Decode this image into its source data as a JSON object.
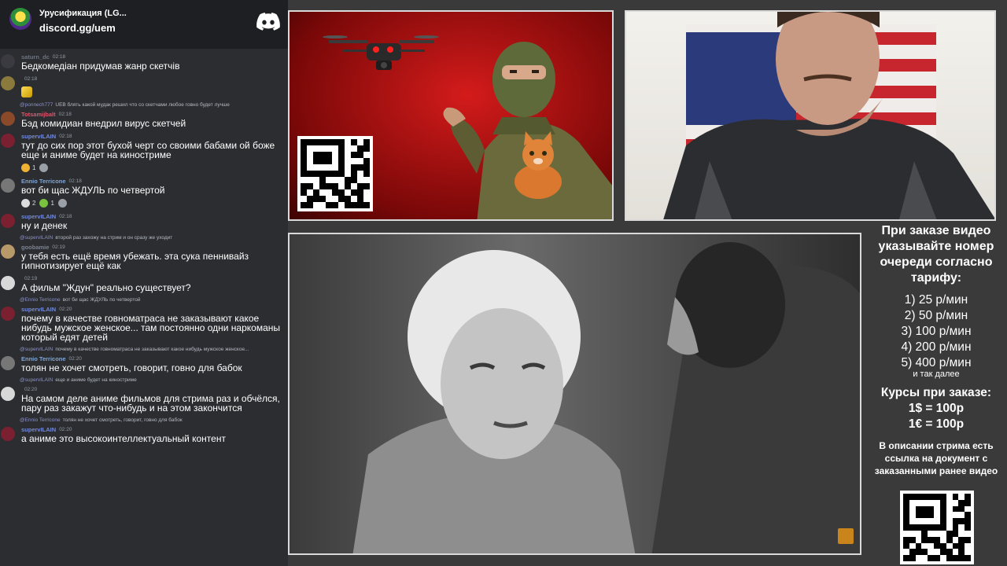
{
  "header": {
    "server_name": "Урусификация (LG...",
    "invite": "discord.gg/uem"
  },
  "messages": [
    {
      "user": "saturn_dc",
      "user_color": "#6d7480",
      "time": "02:18",
      "text": "Бедкомедіан придумав жанр скетчів",
      "avatar_color": "#3a3a40"
    },
    {
      "user": "",
      "user_color": "#4e5058",
      "time": "02:18",
      "text": "",
      "avatar_color": "#8a7a3c",
      "attachment": true
    },
    {
      "reply_user": "@ponnech777",
      "reply_text": "UEB блять какой мудак решил что со скетчами любое говно будет лучше",
      "user": "Totsamijbalt",
      "user_color": "#e0556a",
      "time": "02:18",
      "text": "Бэд комидиан внедрил вирус скетчей",
      "avatar_color": "#8a4a2a"
    },
    {
      "user": "supervILAIN",
      "user_color": "#7289da",
      "time": "02:18",
      "text": "тут до сих пор этот бухой черт со своими бабами ой боже еще и аниме будет на киностриме",
      "avatar_color": "#7a2030",
      "reactions": [
        {
          "emoji_color": "#f0b232",
          "count": "1"
        },
        {
          "emoji_color": "#9aa0a8",
          "count": ""
        }
      ]
    },
    {
      "user": "Ennio Terricone",
      "user_color": "#7fa7d6",
      "time": "02:18",
      "text": "вот би щас ЖДУЛЬ по четвертой",
      "avatar_color": "#777",
      "reactions": [
        {
          "emoji_color": "#dcdcdc",
          "count": "2"
        },
        {
          "emoji_color": "#7cc040",
          "count": "1"
        },
        {
          "emoji_color": "#9aa0a8",
          "count": ""
        }
      ]
    },
    {
      "user": "supervILAIN",
      "user_color": "#7289da",
      "time": "02:18",
      "text": "ну и денек",
      "avatar_color": "#7a2030"
    },
    {
      "reply_user": "@supervILAIN",
      "reply_text": "второй раз захожу на стрим и он сразу же уходит",
      "user": "goobamie",
      "user_color": "#7d8290",
      "time": "02:19",
      "text": "у тебя есть ещё время убежать. эта сука пеннивайз гипнотизирует ещё как",
      "avatar_color": "#b89a6a"
    },
    {
      "user": "",
      "user_color": "#4e5058",
      "time": "02:19",
      "text": "А фильм \"Ждун\" реально существует?",
      "avatar_color": "#d8d8d8"
    },
    {
      "reply_user": "@Ennio Terricone",
      "reply_text": "вот би щас ЖДУЛЬ по четвертой",
      "user": "supervILAIN",
      "user_color": "#7289da",
      "time": "02:20",
      "text": "почему в качестве говноматраса не заказывают какое нибудь мужское женское... там постоянно одни наркоманы который едят детей",
      "avatar_color": "#7a2030"
    },
    {
      "reply_user": "@supervILAIN",
      "reply_text": "почему в качестве говноматраса не заказывают какое нибудь мужское женское...",
      "user": "Ennio Terricone",
      "user_color": "#7fa7d6",
      "time": "02:20",
      "text": "толян не хочет смотреть, говорит, говно для бабок",
      "avatar_color": "#777"
    },
    {
      "reply_user": "@supervILAIN",
      "reply_text": "еще и аниме будет на киностриме",
      "user": "",
      "user_color": "#4e5058",
      "time": "02:20",
      "text": "На самом деле аниме фильмов для стрима раз и обчёлся, пару раз закажут что-нибудь и на этом закончится",
      "avatar_color": "#d8d8d8"
    },
    {
      "reply_user": "@Ennio Terricone",
      "reply_text": "толян не хочет смотреть, говорит, говно для бабок",
      "user": "supervILAIN",
      "user_color": "#7289da",
      "time": "02:20",
      "text": "а аниме это высокоинтеллектуальный контент",
      "avatar_color": "#7a2030"
    }
  ],
  "sidebar": {
    "order_note": "При заказе видео указывайте номер очереди согласно тарифу:",
    "tariffs": [
      "1) 25 р/мин",
      "2) 50 р/мин",
      "3) 100 р/мин",
      "4) 200 р/мин",
      "5) 400 р/мин"
    ],
    "and_so_on": "и так далее",
    "rates_title": "Курсы при заказе:",
    "rates": [
      "1$ = 100р",
      "1€ = 100р"
    ],
    "desc_note": "В описании стрима есть ссылка на документ с заказанными ранее видео"
  },
  "colors": {
    "chat_bg": "#2b2d31",
    "header_bg": "#1e1f22",
    "poster_red": "#c31616",
    "frame_border": "#d9d9d9"
  },
  "icons": {
    "discord": "discord-logo-icon",
    "qr": "qr-code-icon"
  }
}
